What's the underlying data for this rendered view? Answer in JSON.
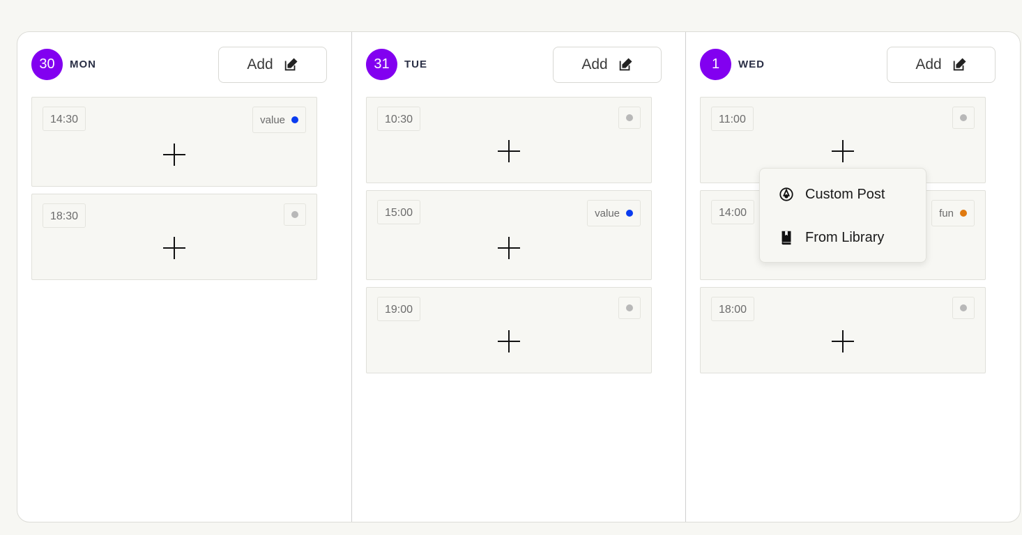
{
  "columns": [
    {
      "day_number": "30",
      "day_name": "MON",
      "add_label": "Add",
      "slots": [
        {
          "time": "14:30",
          "tag": "value",
          "tag_color": "#0a3cf0"
        },
        {
          "time": "18:30",
          "tag": "",
          "tag_color": "#b8b8b8"
        }
      ]
    },
    {
      "day_number": "31",
      "day_name": "TUE",
      "add_label": "Add",
      "slots": [
        {
          "time": "10:30",
          "tag": "",
          "tag_color": "#b8b8b8"
        },
        {
          "time": "15:00",
          "tag": "value",
          "tag_color": "#0a3cf0"
        },
        {
          "time": "19:00",
          "tag": "",
          "tag_color": "#b8b8b8"
        }
      ]
    },
    {
      "day_number": "1",
      "day_name": "WED",
      "add_label": "Add",
      "slots": [
        {
          "time": "11:00",
          "tag": "",
          "tag_color": "#b8b8b8"
        },
        {
          "time": "14:00",
          "tag": "fun",
          "tag_color": "#e07a10"
        },
        {
          "time": "18:00",
          "tag": "",
          "tag_color": "#b8b8b8"
        }
      ]
    }
  ],
  "dropdown": {
    "items": [
      {
        "label": "Custom Post",
        "icon": "pen-nib-circle-icon"
      },
      {
        "label": "From Library",
        "icon": "book-icon"
      }
    ]
  },
  "colors": {
    "accent": "#8200f0",
    "blue_tag": "#0a3cf0",
    "orange_tag": "#e07a10",
    "empty_tag": "#b8b8b8"
  }
}
